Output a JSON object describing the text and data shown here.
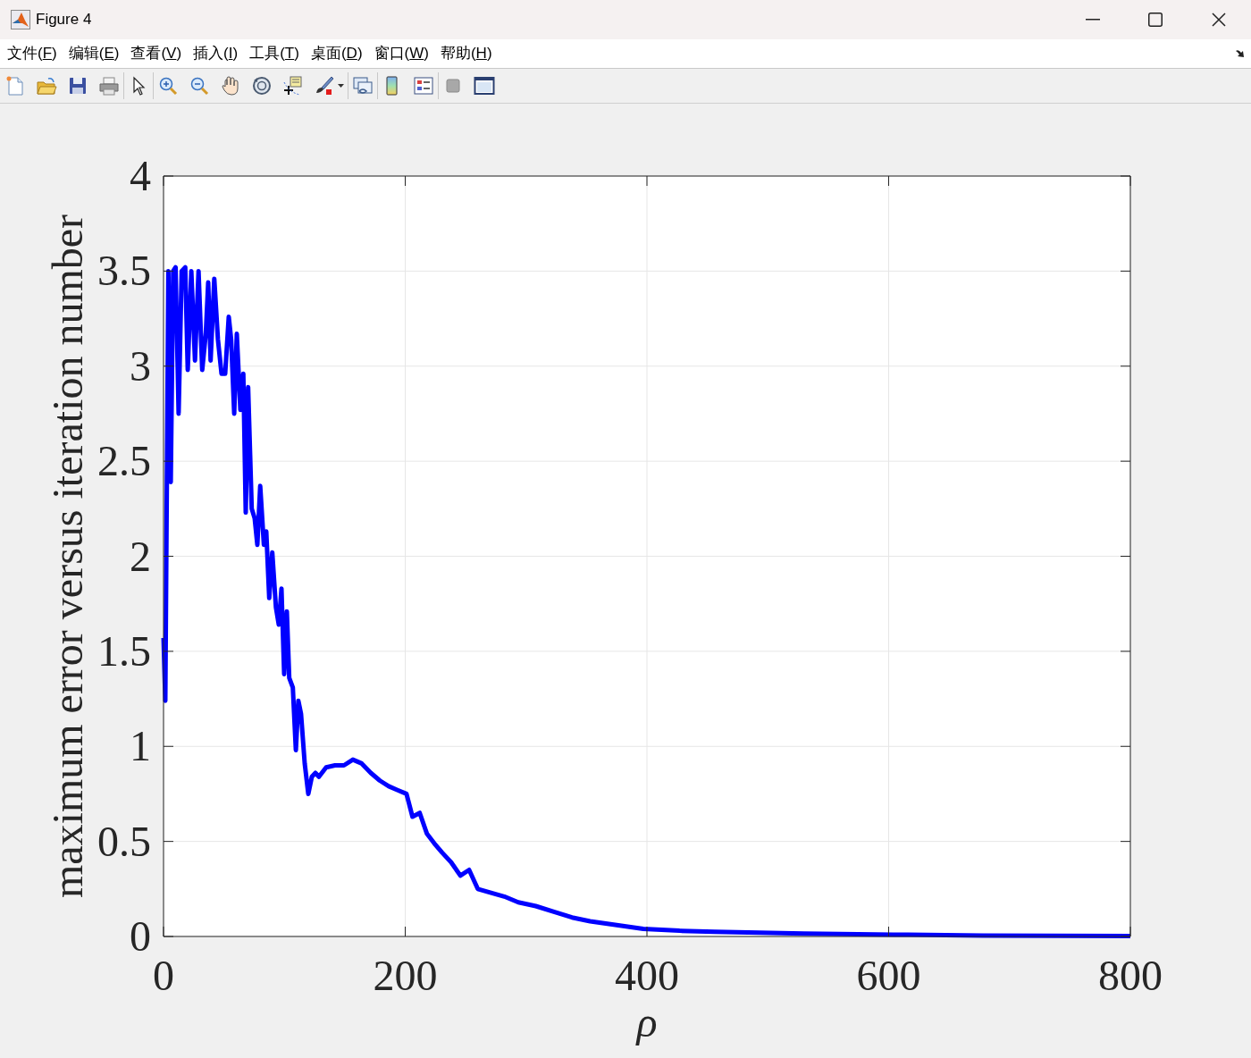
{
  "window": {
    "title": "Figure 4"
  },
  "menu": [
    "文件(F)",
    "编辑(E)",
    "查看(V)",
    "插入(I)",
    "工具(T)",
    "桌面(D)",
    "窗口(W)",
    "帮助(H)"
  ],
  "toolbar": [
    [
      {
        "kind": "new"
      },
      {
        "kind": "open"
      },
      {
        "kind": "save"
      },
      {
        "kind": "print"
      }
    ],
    [
      {
        "kind": "pointer"
      }
    ],
    [
      {
        "kind": "zoom-in"
      },
      {
        "kind": "zoom-out"
      },
      {
        "kind": "pan"
      },
      {
        "kind": "rotate"
      },
      {
        "kind": "data-cursor"
      },
      {
        "kind": "brush"
      }
    ],
    [
      {
        "kind": "link"
      }
    ],
    [
      {
        "kind": "colorbar"
      },
      {
        "kind": "legend"
      }
    ],
    [
      {
        "kind": "hide"
      },
      {
        "kind": "dock"
      }
    ]
  ],
  "chart_data": {
    "type": "line",
    "grid": true,
    "xlabel": "ρ",
    "ylabel": "maximum error versus iteration number",
    "xlim": [
      0,
      800
    ],
    "ylim": [
      0,
      4
    ],
    "xticks": [
      0,
      200,
      400,
      600,
      800
    ],
    "yticks": [
      {
        "value": 0,
        "label": "0"
      },
      {
        "value": 0.5,
        "label": "0.5"
      },
      {
        "value": 1,
        "label": "1"
      },
      {
        "value": 1.5,
        "label": "1.5"
      },
      {
        "value": 2,
        "label": "2"
      },
      {
        "value": 2.5,
        "label": "2.5"
      },
      {
        "value": 3,
        "label": "3"
      },
      {
        "value": 3.5,
        "label": "3.5"
      },
      {
        "value": 4,
        "label": "4"
      }
    ],
    "x": [
      0,
      1.5,
      4,
      6,
      8,
      10,
      12.5,
      15,
      18,
      20,
      23,
      26,
      29,
      32,
      35,
      37,
      39,
      42,
      45,
      48,
      51,
      54,
      56,
      58.5,
      60.6,
      63.6,
      66,
      68,
      70,
      73,
      75.4,
      77.6,
      80,
      83,
      85,
      87.5,
      90,
      93,
      95.4,
      97.6,
      99.8,
      102,
      104,
      107,
      109.5,
      111.6,
      113.8,
      116.8,
      119.8,
      122.7,
      125.7,
      128.6,
      134.6,
      141.9,
      149.3,
      156.7,
      164,
      171.5,
      178.9,
      186.3,
      193.7,
      201,
      206,
      212,
      218,
      224,
      230.7,
      238,
      245.6,
      252.9,
      260,
      271,
      282,
      293.5,
      308,
      323,
      338,
      353,
      375,
      397,
      427,
      456,
      493,
      530,
      604,
      678,
      800
    ],
    "series": [
      {
        "color": "#0000ff",
        "values": [
          1.57,
          1.24,
          3.5,
          2.39,
          3.5,
          3.52,
          2.75,
          3.5,
          3.52,
          2.98,
          3.5,
          3.03,
          3.5,
          2.98,
          3.17,
          3.44,
          3.03,
          3.46,
          3.14,
          2.96,
          2.96,
          3.26,
          3.14,
          2.75,
          3.17,
          2.77,
          2.96,
          2.23,
          2.89,
          2.25,
          2.2,
          2.06,
          2.37,
          2.06,
          2.13,
          1.78,
          2.02,
          1.73,
          1.64,
          1.83,
          1.38,
          1.71,
          1.36,
          1.31,
          0.98,
          1.24,
          1.17,
          0.91,
          0.75,
          0.84,
          0.86,
          0.84,
          0.89,
          0.9,
          0.9,
          0.93,
          0.91,
          0.86,
          0.82,
          0.79,
          0.77,
          0.75,
          0.63,
          0.65,
          0.54,
          0.49,
          0.44,
          0.39,
          0.32,
          0.35,
          0.25,
          0.23,
          0.21,
          0.18,
          0.16,
          0.13,
          0.1,
          0.08,
          0.06,
          0.04,
          0.03,
          0.025,
          0.02,
          0.015,
          0.01,
          0.005,
          0.003
        ]
      }
    ]
  }
}
